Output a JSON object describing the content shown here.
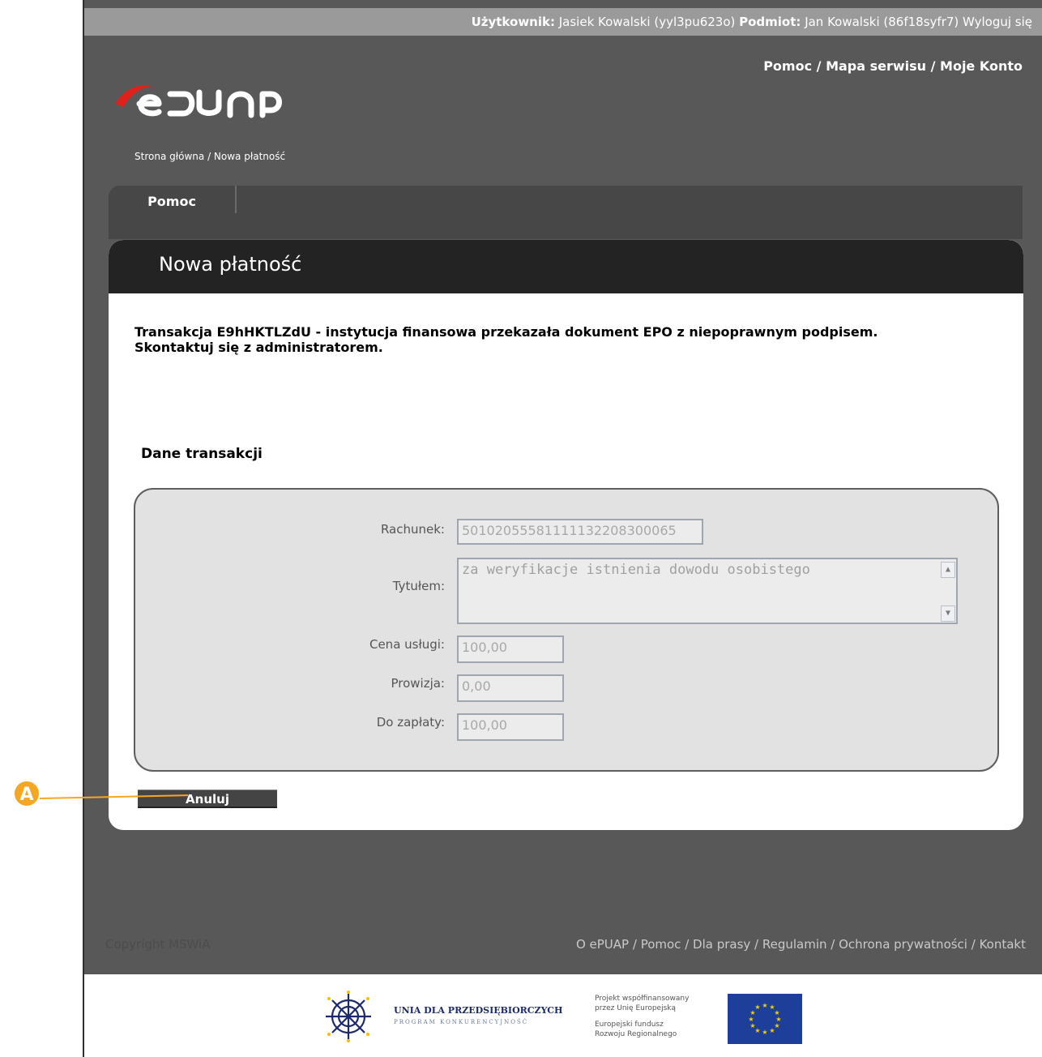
{
  "topbar": {
    "user_label": "Użytkownik:",
    "user_value": " Jasiek Kowalski (yyl3pu623o) ",
    "entity_label": "Podmiot:",
    "entity_value": " Jan Kowalski (86f18syfr7) ",
    "logout": "Wyloguj się"
  },
  "toplinks": {
    "help": "Pomoc",
    "sep1": " / ",
    "sitemap": "Mapa serwisu",
    "sep2": " / ",
    "account": "Moje Konto"
  },
  "breadcrumb": {
    "home": "Strona główna",
    "sep": " / ",
    "current": "Nowa płatność"
  },
  "tabs": [
    {
      "label": "Pomoc"
    }
  ],
  "panel": {
    "title": "Nowa płatność",
    "message_line1": "Transakcja E9hHKTLZdU - instytucja finansowa przekazała dokument EPO z niepoprawnym podpisem.",
    "message_line2": "Skontaktuj się z administratorem.",
    "section_title": "Dane transakcji"
  },
  "form": {
    "account": {
      "label": "Rachunek:",
      "value": "50102055581111132208300065"
    },
    "title": {
      "label": "Tytułem:",
      "value": "za weryfikacje istnienia dowodu osobistego"
    },
    "price": {
      "label": "Cena usługi:",
      "value": "100,00"
    },
    "commission": {
      "label": "Prowizja:",
      "value": "0,00"
    },
    "total": {
      "label": "Do zapłaty:",
      "value": "100,00"
    }
  },
  "buttons": {
    "cancel": "Anuluj"
  },
  "annotation": {
    "badge": "A",
    "color": "#f5a623"
  },
  "footer": {
    "copyright": "Copyright MSWiA",
    "links": [
      {
        "label": "O ePUAP"
      },
      {
        "label": "Pomoc"
      },
      {
        "label": "Dla prasy"
      },
      {
        "label": "Regulamin"
      },
      {
        "label": "Ochrona prywatności"
      },
      {
        "label": "Kontakt"
      }
    ],
    "link_sep": " / ",
    "unia_title": "UNIA DLA PRZEDSIĘBIORCZYCH",
    "unia_sub": "PROGRAM KONKURENCYJNOŚĆ",
    "eu_line1": "Projekt współfinansowany",
    "eu_line2": "przez Unię Europejską",
    "eu_line3": "Europejski fundusz",
    "eu_line4": "Rozwoju Regionalnego"
  },
  "colors": {
    "frame": "#585858",
    "topbar": "#9a9a9a",
    "panel_header": "#232323",
    "accent_logo_red": "#e0201b"
  },
  "icons": {
    "scroll_up": "scroll-up-icon",
    "scroll_down": "scroll-down-icon",
    "logo": "epuap-logo"
  }
}
